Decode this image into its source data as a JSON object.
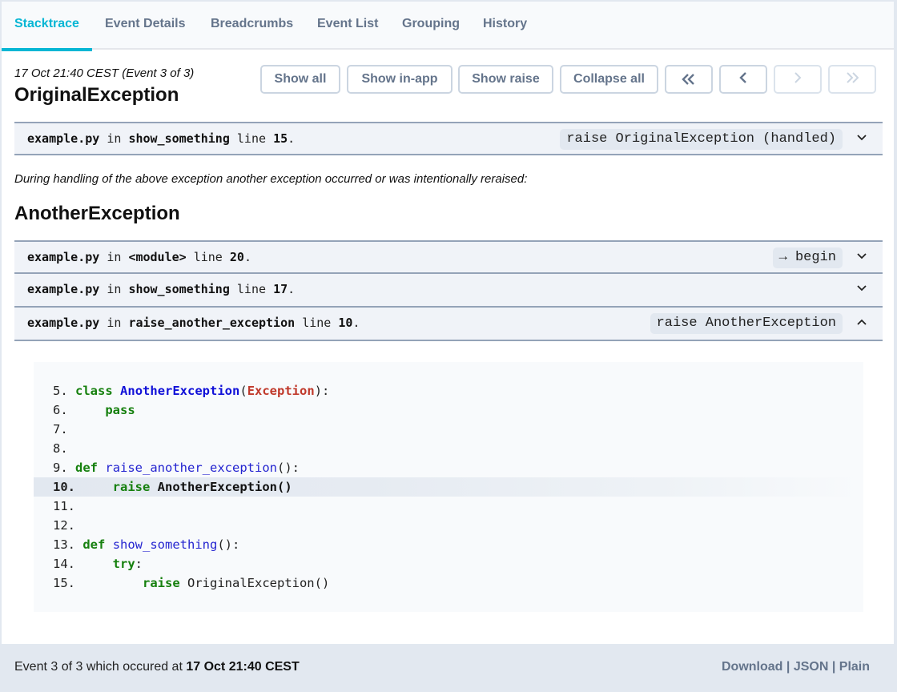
{
  "tabs": [
    {
      "label": "Stacktrace",
      "active": true
    },
    {
      "label": "Event Details",
      "active": false
    },
    {
      "label": "Breadcrumbs",
      "active": false
    },
    {
      "label": "Event List",
      "active": false
    },
    {
      "label": "Grouping",
      "active": false
    },
    {
      "label": "History",
      "active": false
    }
  ],
  "event_meta": "17 Oct 21:40 CEST (Event 3 of 3)",
  "toolbar": {
    "show_all": "Show all",
    "show_in_app": "Show in-app",
    "show_raise": "Show raise",
    "collapse_all": "Collapse all",
    "first_icon": "double-chevron-left-icon",
    "prev_icon": "chevron-left-icon",
    "next_icon": "chevron-right-icon",
    "last_icon": "double-chevron-right-icon",
    "first_glyph": "«",
    "prev_glyph": "‹",
    "next_glyph": "›",
    "last_glyph": "»"
  },
  "exceptions": [
    {
      "title": "OriginalException",
      "frames": [
        {
          "file": "example.py",
          "in": "in",
          "function": "show_something",
          "line_word": "line",
          "line": "15",
          "dot": ".",
          "badge": "raise OriginalException (handled)",
          "expanded": false
        }
      ]
    },
    {
      "title": "AnotherException",
      "frames": [
        {
          "file": "example.py",
          "in": "in",
          "function": "<module>",
          "line_word": "line",
          "line": "20",
          "dot": ".",
          "badge": "→ begin",
          "expanded": false
        },
        {
          "file": "example.py",
          "in": "in",
          "function": "show_something",
          "line_word": "line",
          "line": "17",
          "dot": ".",
          "badge": "",
          "expanded": false
        },
        {
          "file": "example.py",
          "in": "in",
          "function": "raise_another_exception",
          "line_word": "line",
          "line": "10",
          "dot": ".",
          "badge": "raise AnotherException",
          "expanded": true
        }
      ]
    }
  ],
  "chain_note": "During handling of the above exception another exception occurred or was intentionally reraised:",
  "code": {
    "highlight_line": 10,
    "lines": [
      {
        "n": "5.",
        "tokens": [
          [
            "kw",
            "class"
          ],
          [
            "",
            " "
          ],
          [
            "cls",
            "AnotherException"
          ],
          [
            "",
            "("
          ],
          [
            "bi",
            "Exception"
          ],
          [
            "",
            "):"
          ]
        ]
      },
      {
        "n": "6.",
        "tokens": [
          [
            "",
            "    "
          ],
          [
            "kw",
            "pass"
          ]
        ]
      },
      {
        "n": "7.",
        "tokens": []
      },
      {
        "n": "8.",
        "tokens": []
      },
      {
        "n": "9.",
        "tokens": [
          [
            "kw",
            "def"
          ],
          [
            "",
            " "
          ],
          [
            "fn",
            "raise_another_exception"
          ],
          [
            "",
            "():"
          ]
        ]
      },
      {
        "n": "10.",
        "tokens": [
          [
            "",
            "    "
          ],
          [
            "kw",
            "raise"
          ],
          [
            "",
            " AnotherException()"
          ]
        ]
      },
      {
        "n": "11.",
        "tokens": []
      },
      {
        "n": "12.",
        "tokens": []
      },
      {
        "n": "13.",
        "tokens": [
          [
            "kw",
            "def"
          ],
          [
            "",
            " "
          ],
          [
            "fn",
            "show_something"
          ],
          [
            "",
            "():"
          ]
        ]
      },
      {
        "n": "14.",
        "tokens": [
          [
            "",
            "    "
          ],
          [
            "kw",
            "try"
          ],
          [
            "",
            ":"
          ]
        ]
      },
      {
        "n": "15.",
        "tokens": [
          [
            "",
            "        "
          ],
          [
            "kw",
            "raise"
          ],
          [
            "",
            " OriginalException()"
          ]
        ]
      }
    ]
  },
  "footer": {
    "prefix": "Event 3 of 3 which occured at ",
    "timestamp": "17 Oct 21:40 CEST",
    "download": "Download",
    "json": "JSON",
    "plain": "Plain",
    "sep": " | "
  }
}
